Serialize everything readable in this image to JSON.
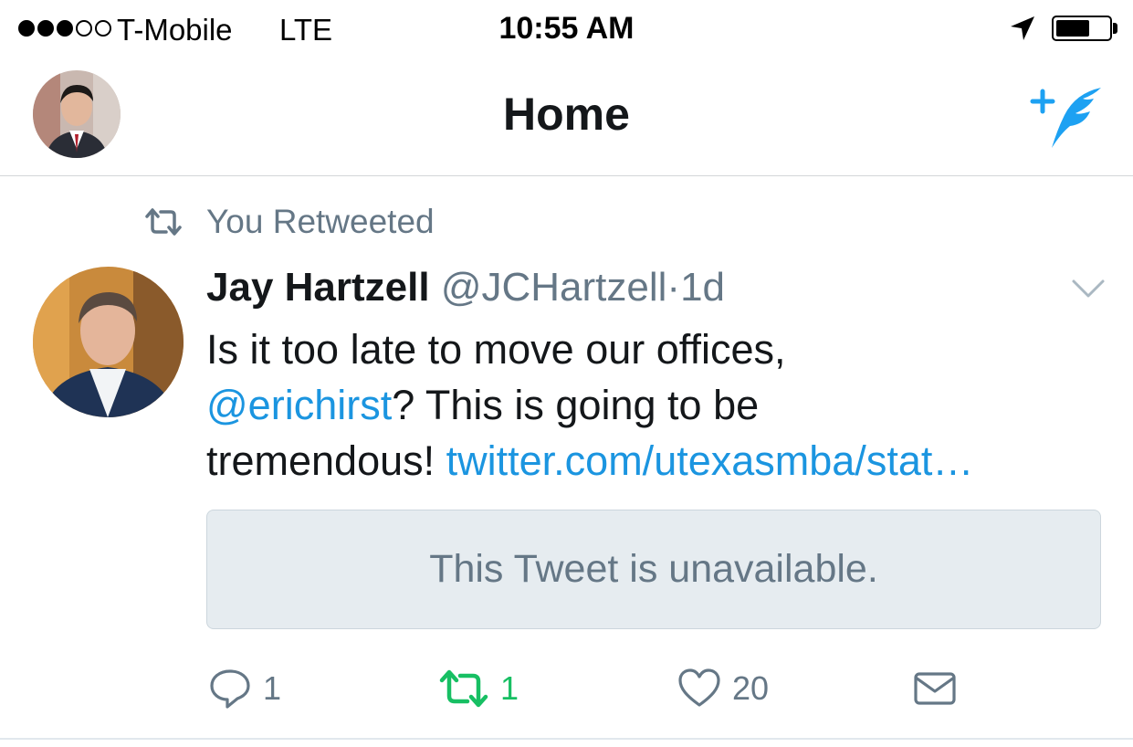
{
  "status_bar": {
    "carrier": "T-Mobile",
    "network": "LTE",
    "time": "10:55 AM",
    "signal_filled": 3,
    "signal_total": 5,
    "battery_level": 0.65,
    "icons": [
      "location-arrow-icon",
      "battery-icon"
    ]
  },
  "nav": {
    "title": "Home",
    "left": "profile-avatar",
    "right": "compose-tweet-icon"
  },
  "tweet": {
    "context": "You Retweeted",
    "author": {
      "name": "Jay Hartzell",
      "handle": "@JCHartzell",
      "separator": "·",
      "time": "1d"
    },
    "text": {
      "line1": "Is it too late to move our offices,",
      "mention": "@erichirst",
      "line2_rest": "?  This is going to be",
      "line3_start": "tremendous! ",
      "link": "twitter.com/utexasmba/stat…"
    },
    "quoted_card": "This Tweet is unavailable.",
    "actions": {
      "reply_count": "1",
      "retweet_count": "1",
      "like_count": "20"
    }
  },
  "colors": {
    "link": "#1b95e0",
    "secondary_text": "#657786",
    "retweet_active": "#17bf63",
    "card_bg": "#e6ecf0"
  }
}
